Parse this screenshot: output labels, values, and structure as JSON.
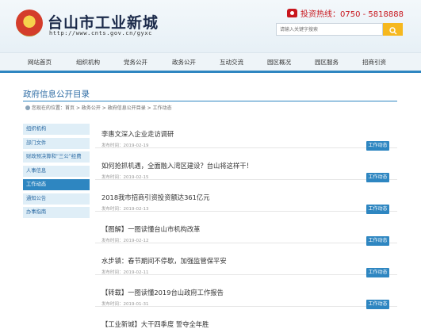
{
  "header": {
    "site_title": "台山市工业新城",
    "site_url": "http://www.cnts.gov.cn/gyxc",
    "hotline": "投资热线：0750 - 5818888",
    "search_placeholder": "请输入关键字搜索",
    "colors": {
      "accent": "#2e86c1",
      "search_button": "#f6b81e",
      "hotline": "#c8161d"
    }
  },
  "nav": {
    "items": [
      "网站首页",
      "组织机构",
      "党务公开",
      "政务公开",
      "互动交流",
      "园区概况",
      "园区服务",
      "招商引资"
    ]
  },
  "page": {
    "title": "政府信息公开目录",
    "breadcrumb": {
      "prefix": "您现在的位置：",
      "items": [
        "首页",
        "政务公开",
        "政府信息公开目录",
        "工作动态"
      ],
      "separator": " > "
    }
  },
  "sidebar": {
    "items": [
      {
        "label": "组织机构",
        "active": false
      },
      {
        "label": "部门文件",
        "active": false
      },
      {
        "label": "财政预决算和“三公”经费",
        "active": false
      },
      {
        "label": "人事信息",
        "active": false
      },
      {
        "label": "工作动态",
        "active": true
      },
      {
        "label": "通知公告",
        "active": false
      },
      {
        "label": "办事指南",
        "active": false
      }
    ]
  },
  "list": {
    "date_prefix": "发布时间：",
    "items": [
      {
        "title": "李惠文深入企业走访调研",
        "date": "2019-02-19",
        "tag": "工作动态"
      },
      {
        "title": "如何抢抓机遇，全面融入湾区建设？台山将这样干！",
        "date": "2019-02-15",
        "tag": "工作动态"
      },
      {
        "title": "2018我市招商引资投资额达361亿元",
        "date": "2019-02-13",
        "tag": "工作动态"
      },
      {
        "title": "【图解】一图读懂台山市机构改革",
        "date": "2019-02-12",
        "tag": "工作动态"
      },
      {
        "title": "水步镇：春节期间不停歇，加强监管保平安",
        "date": "2019-02-11",
        "tag": "工作动态"
      },
      {
        "title": "【转载】一图读懂2019台山政府工作报告",
        "date": "2019-01-31",
        "tag": "工作动态"
      }
    ],
    "partial_item_title": "【工业新城】大干四季度 誓夺全年胜"
  }
}
